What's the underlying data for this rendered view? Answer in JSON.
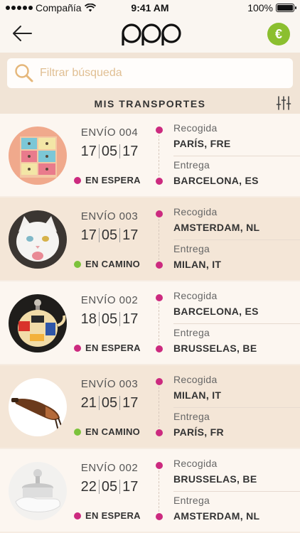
{
  "status_bar": {
    "carrier": "Compañía",
    "time": "9:41 AM",
    "battery": "100%",
    "battery_level": 1.0
  },
  "nav": {
    "back_icon": "back-arrow-icon",
    "logo_icon": "brand-logo-icon",
    "currency_symbol": "€",
    "accent_color": "#8bbf2f"
  },
  "search": {
    "placeholder": "Filtrar búsqueda",
    "value": ""
  },
  "section": {
    "title": "MIS TRANSPORTES",
    "filter_icon": "sliders-icon"
  },
  "colors": {
    "magenta": "#cc2a7f",
    "waiting": "#cc2a7f",
    "in_transit": "#7cc23b"
  },
  "shipments": [
    {
      "title": "ENVÍO 004",
      "day": "17",
      "month": "05",
      "year": "17",
      "status": "EN ESPERA",
      "status_color": "#cc2a7f",
      "image": "drawer-box-image",
      "pickup_label": "Recogida",
      "pickup_place": "PARÍS, FRE",
      "delivery_label": "Entrega",
      "delivery_place": "BARCELONA, ES"
    },
    {
      "title": "ENVÍO 003",
      "day": "17",
      "month": "05",
      "year": "17",
      "status": "EN CAMINO",
      "status_color": "#7cc23b",
      "image": "white-cat-image",
      "pickup_label": "Recogida",
      "pickup_place": "AMSTERDAM, NL",
      "delivery_label": "Entrega",
      "delivery_place": "MILAN, IT"
    },
    {
      "title": "ENVÍO 002",
      "day": "18",
      "month": "05",
      "year": "17",
      "status": "EN ESPERA",
      "status_color": "#cc2a7f",
      "image": "teapot-lamp-image",
      "pickup_label": "Recogida",
      "pickup_place": "BARCELONA, ES",
      "delivery_label": "Entrega",
      "delivery_place": "BRUSSELAS, BE"
    },
    {
      "title": "ENVÍO 003",
      "day": "21",
      "month": "05",
      "year": "17",
      "status": "EN CAMINO",
      "status_color": "#7cc23b",
      "image": "ham-leg-image",
      "pickup_label": "Recogida",
      "pickup_place": "MILAN, IT",
      "delivery_label": "Entrega",
      "delivery_place": "PARÍS, FR"
    },
    {
      "title": "ENVÍO 002",
      "day": "22",
      "month": "05",
      "year": "17",
      "status": "EN ESPERA",
      "status_color": "#cc2a7f",
      "image": "ashtray-image",
      "pickup_label": "Recogida",
      "pickup_place": "BRUSSELAS, BE",
      "delivery_label": "Entrega",
      "delivery_place": "AMSTERDAM, NL"
    }
  ]
}
